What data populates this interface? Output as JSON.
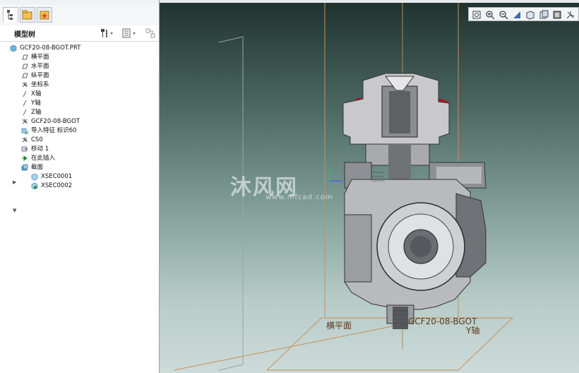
{
  "panel": {
    "tree_title": "模型树",
    "tabs": [
      "model-tree-tab",
      "folder-browser-tab",
      "favorites-tab"
    ]
  },
  "tree": {
    "root": "GCF20-08-BGOT.PRT",
    "items": [
      {
        "label": "横平面",
        "icon": "datum-plane-icon"
      },
      {
        "label": "水平面",
        "icon": "datum-plane-icon"
      },
      {
        "label": "纵平面",
        "icon": "datum-plane-icon"
      },
      {
        "label": "坐标系",
        "icon": "coordinate-system-icon"
      },
      {
        "label": "X轴",
        "icon": "datum-axis-icon"
      },
      {
        "label": "Y轴",
        "icon": "datum-axis-icon"
      },
      {
        "label": "Z轴",
        "icon": "datum-axis-icon"
      },
      {
        "label": "GCF20-08-BGOT",
        "icon": "coordinate-system-icon"
      },
      {
        "label": "导入特征 标识60",
        "icon": "import-feature-icon"
      },
      {
        "label": "CS0",
        "icon": "coordinate-system-icon"
      },
      {
        "label": "移动 1",
        "icon": "move-icon"
      },
      {
        "label": "在此插入",
        "icon": "insert-here-arrow-icon"
      },
      {
        "label": "截面",
        "icon": "section-folder-icon"
      },
      {
        "label": "XSEC0001",
        "icon": "section-icon"
      },
      {
        "label": "XSEC0002",
        "icon": "section-icon"
      }
    ]
  },
  "viewport": {
    "labels": {
      "plane": "横平面",
      "csys": "GCF20-08-BGOT",
      "axis": "Y轴"
    },
    "watermark": "沐风网",
    "watermark_url": "www.mfcad.com",
    "toolbar": [
      "zoom-fit-icon",
      "zoom-in-icon",
      "zoom-out-icon",
      "repaint-icon",
      "display-style-icon",
      "saved-views-icon",
      "view-manager-icon",
      "datum-display-icon"
    ]
  },
  "colors": {
    "part_red": "#b0141c",
    "datum_orange": "#b8743a"
  }
}
